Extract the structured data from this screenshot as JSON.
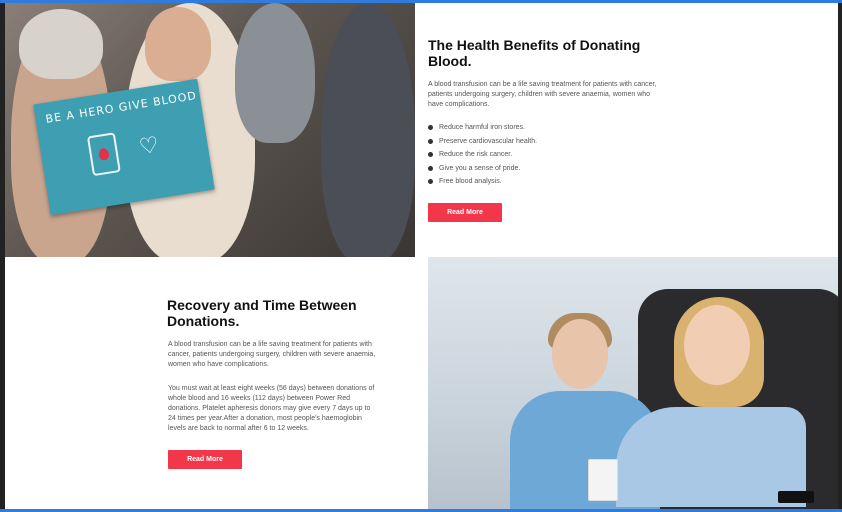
{
  "section1": {
    "sign_text": "BE A HERO GIVE BLOOD",
    "title": "The Health Benefits of Donating Blood.",
    "paragraph": "A blood transfusion can be a life saving treatment for patients with cancer, patients undergoing surgery, children with severe anaemia, women who have complications.",
    "bullets": [
      "Reduce harmful iron stores.",
      "Preserve cardiovascular health.",
      "Reduce the risk cancer.",
      "Give you a sense of pride.",
      "Free blood analysis."
    ],
    "button_label": "Read More"
  },
  "section2": {
    "title": "Recovery and Time Between Donations.",
    "paragraph1": "A blood transfusion can be a life saving treatment for patients with cancer, patients undergoing surgery, children with severe anaemia, women who have complications.",
    "paragraph2": "You must wait at least eight weeks (56 days) between donations of whole blood and 16 weeks (112 days) between Power Red donations. Platelet apheresis donors may give every 7 days up to 24 times per year.After a donation, most people's haemoglobin levels are back to normal after 6 to 12 weeks.",
    "button_label": "Read More"
  },
  "colors": {
    "accent_button": "#f2374a",
    "frame_bar": "#2f7be0",
    "sign_blue": "#3e9fb3"
  }
}
